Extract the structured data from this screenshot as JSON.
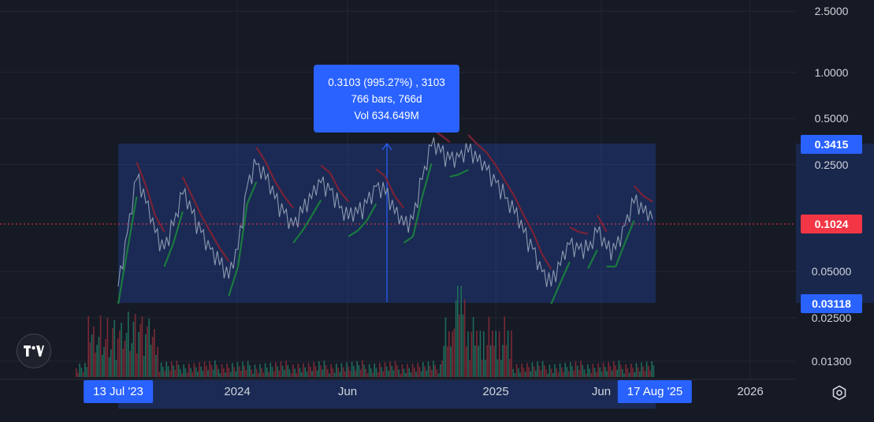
{
  "chart_data": {
    "type": "line",
    "log_scale": true,
    "ylim": [
      0.0105,
      2.6
    ],
    "y_ticks": [
      "2.5000",
      "1.0000",
      "0.5000",
      "0.2500",
      "0.05000",
      "0.02500",
      "0.01300"
    ],
    "x_ticks": [
      "2024",
      "Jun",
      "2025",
      "Jun",
      "2026"
    ],
    "grid": true,
    "series": [
      {
        "values": [
          0.04,
          0.09,
          0.2,
          0.14,
          0.09,
          0.07,
          0.1,
          0.16,
          0.12,
          0.09,
          0.07,
          0.055,
          0.045,
          0.07,
          0.18,
          0.25,
          0.2,
          0.15,
          0.12,
          0.1,
          0.12,
          0.15,
          0.19,
          0.17,
          0.13,
          0.11,
          0.12,
          0.14,
          0.18,
          0.16,
          0.12,
          0.1,
          0.11,
          0.2,
          0.33,
          0.3,
          0.27,
          0.28,
          0.3,
          0.26,
          0.23,
          0.19,
          0.15,
          0.12,
          0.09,
          0.07,
          0.05,
          0.04,
          0.055,
          0.075,
          0.07,
          0.068,
          0.09,
          0.07,
          0.07,
          0.1,
          0.14,
          0.12,
          0.11
        ]
      }
    ],
    "price_range_highlight": {
      "top": "0.3415",
      "bottom": "0.03118",
      "start_date": "13 Jul '23",
      "end_date": "17 Aug '25",
      "label_line1": "0.3103 (995.27%) , 3103",
      "label_line2": "766 bars, 766d",
      "label_line3": "Vol 634.649M"
    },
    "current_price": "0.1024",
    "colors": {
      "background": "#161a25",
      "price_line": "#8c9ab0",
      "supertrend_down": "#7a2236",
      "supertrend_up": "#1b7a3f",
      "volume_up": "#1f6b5a",
      "volume_down": "#7a2a35",
      "highlight_fill": "#2962ff",
      "current_price_badge": "#f23645",
      "range_badge": "#2962ff"
    }
  }
}
